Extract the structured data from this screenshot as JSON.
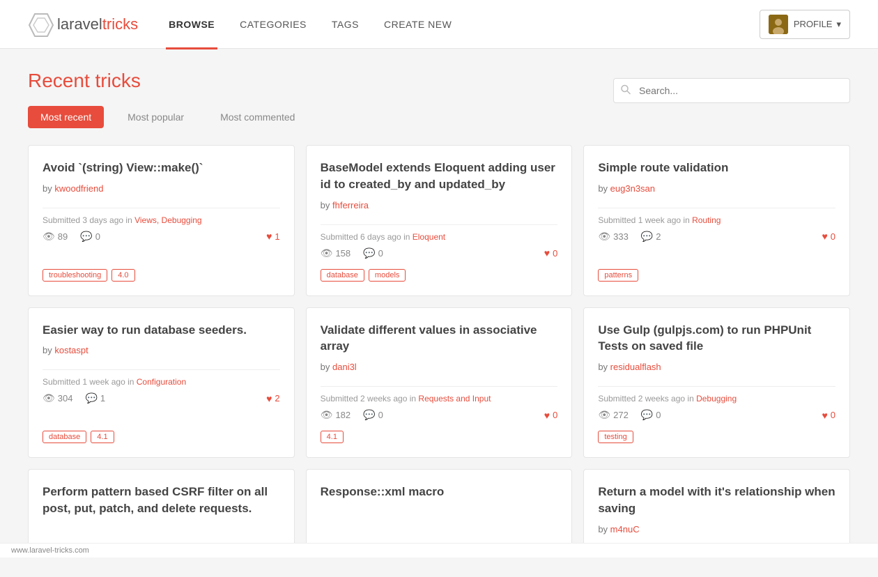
{
  "header": {
    "logo_laravel": "laravel",
    "logo_tricks": "tricks",
    "nav_items": [
      {
        "label": "BROWSE",
        "active": true
      },
      {
        "label": "CATEGORIES",
        "active": false
      },
      {
        "label": "TAGS",
        "active": false
      },
      {
        "label": "CREATE NEW",
        "active": false
      }
    ],
    "profile_label": "PROFILE",
    "profile_caret": "▾"
  },
  "page": {
    "title": "Recent tricks",
    "search_placeholder": "Search..."
  },
  "filters": [
    {
      "label": "Most recent",
      "active": true
    },
    {
      "label": "Most popular",
      "active": false
    },
    {
      "label": "Most commented",
      "active": false
    }
  ],
  "cards": [
    {
      "title": "Avoid `(string) View::make()`",
      "author": "kwoodfriend",
      "meta_time": "Submitted 3 days ago in ",
      "meta_category": "Views, Debugging",
      "views": "89",
      "comments": "0",
      "likes": "1",
      "tags": [
        "troubleshooting",
        "4.0"
      ]
    },
    {
      "title": "BaseModel extends Eloquent adding user id to created_by and updated_by",
      "author": "fhferreira",
      "meta_time": "Submitted 6 days ago in ",
      "meta_category": "Eloquent",
      "views": "158",
      "comments": "0",
      "likes": "0",
      "tags": [
        "database",
        "models"
      ]
    },
    {
      "title": "Simple route validation",
      "author": "eug3n3san",
      "meta_time": "Submitted 1 week ago in ",
      "meta_category": "Routing",
      "views": "333",
      "comments": "2",
      "likes": "0",
      "tags": [
        "patterns"
      ]
    },
    {
      "title": "Easier way to run database seeders.",
      "author": "kostaspt",
      "meta_time": "Submitted 1 week ago in ",
      "meta_category": "Configuration",
      "views": "304",
      "comments": "1",
      "likes": "2",
      "tags": [
        "database",
        "4.1"
      ]
    },
    {
      "title": "Validate different values in associative array",
      "author": "dani3l",
      "meta_time": "Submitted 2 weeks ago in ",
      "meta_category": "Requests and Input",
      "views": "182",
      "comments": "0",
      "likes": "0",
      "tags": [
        "4.1"
      ]
    },
    {
      "title": "Use Gulp (gulpjs.com) to run PHPUnit Tests on saved file",
      "author": "residualflash",
      "meta_time": "Submitted 2 weeks ago in ",
      "meta_category": "Debugging",
      "views": "272",
      "comments": "0",
      "likes": "0",
      "tags": [
        "testing"
      ]
    },
    {
      "title": "Perform pattern based CSRF filter on all post, put, patch, and delete requests.",
      "author": "",
      "meta_time": "",
      "meta_category": "",
      "views": "",
      "comments": "",
      "likes": "",
      "tags": [],
      "partial": true
    },
    {
      "title": "Response::xml macro",
      "author": "",
      "meta_time": "",
      "meta_category": "",
      "views": "",
      "comments": "",
      "likes": "",
      "tags": [],
      "partial": true
    },
    {
      "title": "Return a model with it's relationship when saving",
      "author": "m4nuC",
      "meta_time": "",
      "meta_category": "",
      "views": "",
      "comments": "",
      "likes": "",
      "tags": [],
      "partial": true
    }
  ],
  "statusbar": {
    "url": "www.laravel-tricks.com"
  }
}
